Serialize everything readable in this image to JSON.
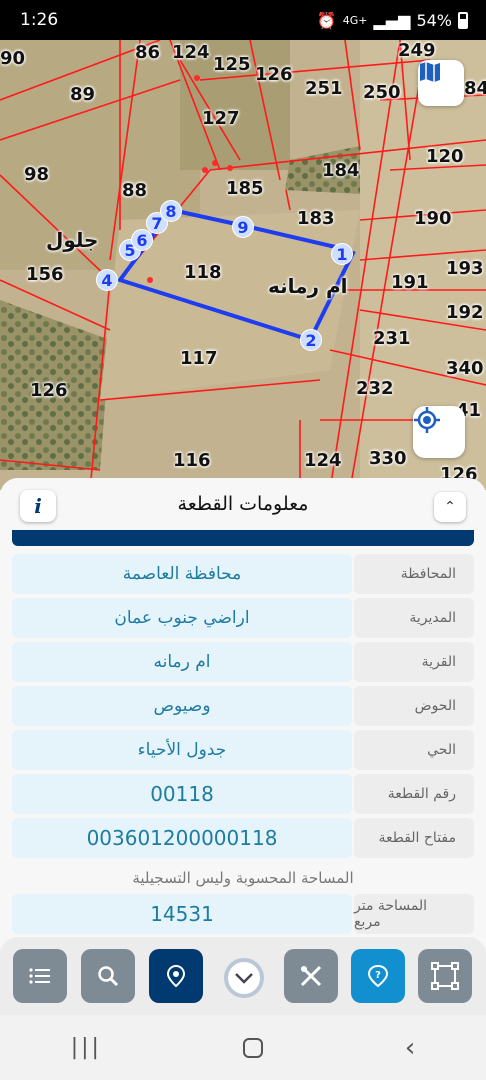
{
  "status": {
    "time": "1:26",
    "network": "4G+",
    "battery": "54%"
  },
  "map": {
    "plot_labels": [
      "90",
      "86",
      "124",
      "125",
      "126",
      "249",
      "89",
      "251",
      "250",
      "127",
      "98",
      "184",
      "120",
      "88",
      "185",
      "183",
      "190",
      "193",
      "156",
      "118",
      "191",
      "192",
      "117",
      "231",
      "340",
      "126",
      "232",
      "116",
      "124",
      "330",
      "41",
      "126",
      "84"
    ],
    "place_labels": [
      "جلول",
      "ام رمانه"
    ],
    "vertices": [
      "1",
      "2",
      "4",
      "5",
      "6",
      "7",
      "8",
      "9"
    ],
    "icons": {
      "layers": "map-layers-icon",
      "locate": "gps-locate-icon"
    }
  },
  "sheet": {
    "title": "معلومات القطعة",
    "info_label": "i",
    "rows": [
      {
        "label": "المحافظة",
        "value": "محافظة العاصمة"
      },
      {
        "label": "المديرية",
        "value": "اراضي جنوب عمان"
      },
      {
        "label": "القرية",
        "value": "ام رمانه"
      },
      {
        "label": "الحوض",
        "value": "وصيوص"
      },
      {
        "label": "الحي",
        "value": "جدول الأحياء"
      },
      {
        "label": "رقم القطعة",
        "value": "00118"
      },
      {
        "label": "مفتاح القطعة",
        "value": "003601200000118"
      }
    ],
    "note": "المساحة المحسوبة وليس التسجيلية",
    "area": {
      "label": "المساحة متر مربع",
      "value": "14531"
    }
  },
  "toolbar": {
    "buttons": [
      "list-icon",
      "search-icon",
      "location-pin-icon",
      "chevron-down-icon",
      "measure-tool-icon",
      "help-icon",
      "polygon-select-icon"
    ]
  },
  "colors": {
    "navy": "#003a70",
    "accent_blue": "#118fcf",
    "value_bg": "#e5f3fa",
    "value_text": "#1e7ca0",
    "parcel_outline": "#1e3cf0",
    "cadastre_lines": "#ff1a1a"
  }
}
